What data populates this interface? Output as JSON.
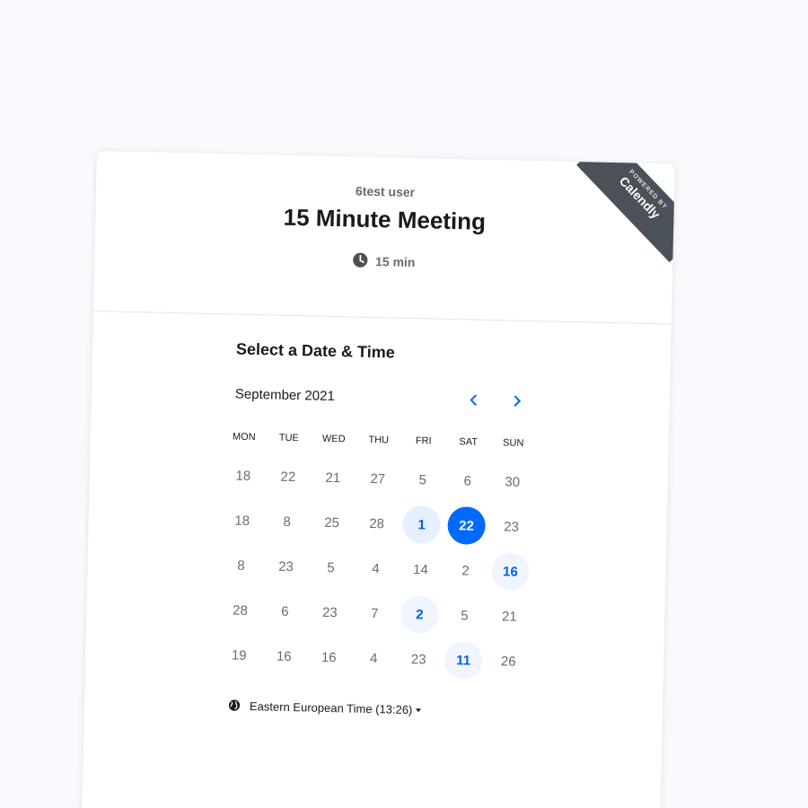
{
  "event": {
    "host": "6test user",
    "title": "15 Minute Meeting",
    "duration": "15 min"
  },
  "ribbon": {
    "powered_by": "POWERED BY",
    "brand": "Calendly"
  },
  "calendar": {
    "heading": "Select a Date & Time",
    "month_label": "September 2021",
    "prev_icon": "chevron-left-icon",
    "next_icon": "chevron-right-icon",
    "weekdays": [
      "MON",
      "TUE",
      "WED",
      "THU",
      "FRI",
      "SAT",
      "SUN"
    ],
    "weeks": [
      [
        {
          "d": "18"
        },
        {
          "d": "22"
        },
        {
          "d": "21"
        },
        {
          "d": "27"
        },
        {
          "d": "5"
        },
        {
          "d": "6"
        },
        {
          "d": "30"
        }
      ],
      [
        {
          "d": "18"
        },
        {
          "d": "8"
        },
        {
          "d": "25"
        },
        {
          "d": "28"
        },
        {
          "d": "1",
          "state": "available"
        },
        {
          "d": "22",
          "state": "selected"
        },
        {
          "d": "23"
        }
      ],
      [
        {
          "d": "8"
        },
        {
          "d": "23"
        },
        {
          "d": "5"
        },
        {
          "d": "4"
        },
        {
          "d": "14"
        },
        {
          "d": "2"
        },
        {
          "d": "16",
          "state": "available-light"
        }
      ],
      [
        {
          "d": "28"
        },
        {
          "d": "6"
        },
        {
          "d": "23"
        },
        {
          "d": "7"
        },
        {
          "d": "2",
          "state": "available-light"
        },
        {
          "d": "5"
        },
        {
          "d": "21"
        }
      ],
      [
        {
          "d": "19"
        },
        {
          "d": "16"
        },
        {
          "d": "16"
        },
        {
          "d": "4"
        },
        {
          "d": "23"
        },
        {
          "d": "11",
          "state": "available-light"
        },
        {
          "d": "26"
        }
      ]
    ]
  },
  "timezone": {
    "label": "Eastern European Time",
    "time": "(13:26)"
  },
  "colors": {
    "accent": "#0069ff",
    "available_bg": "#e6efff",
    "ribbon_bg": "#4a5158"
  }
}
